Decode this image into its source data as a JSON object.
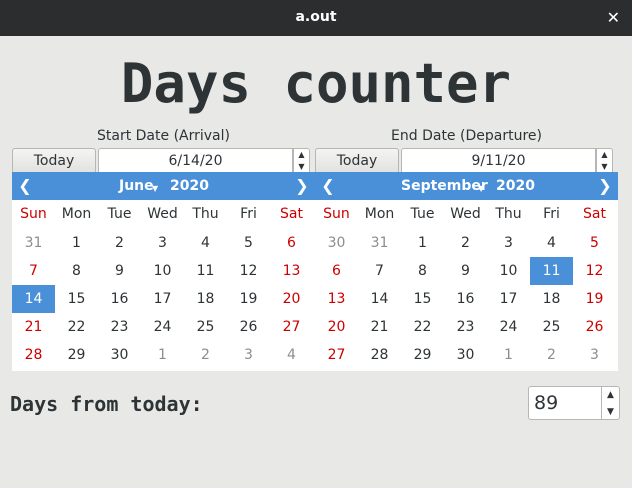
{
  "window": {
    "title": "a.out",
    "close_glyph": "✕"
  },
  "heading": "Days counter",
  "start": {
    "label": "Start Date (Arrival)",
    "today_label": "Today",
    "date_value": "6/14/20",
    "calendar": {
      "month": "June",
      "year": "2020",
      "weekdays": [
        "Sun",
        "Mon",
        "Tue",
        "Wed",
        "Thu",
        "Fri",
        "Sat"
      ],
      "weeks": [
        [
          {
            "d": "31",
            "o": true
          },
          {
            "d": "1"
          },
          {
            "d": "2"
          },
          {
            "d": "3"
          },
          {
            "d": "4"
          },
          {
            "d": "5"
          },
          {
            "d": "6"
          }
        ],
        [
          {
            "d": "7"
          },
          {
            "d": "8"
          },
          {
            "d": "9"
          },
          {
            "d": "10"
          },
          {
            "d": "11"
          },
          {
            "d": "12"
          },
          {
            "d": "13"
          }
        ],
        [
          {
            "d": "14",
            "s": true
          },
          {
            "d": "15"
          },
          {
            "d": "16"
          },
          {
            "d": "17"
          },
          {
            "d": "18"
          },
          {
            "d": "19"
          },
          {
            "d": "20"
          }
        ],
        [
          {
            "d": "21"
          },
          {
            "d": "22"
          },
          {
            "d": "23"
          },
          {
            "d": "24"
          },
          {
            "d": "25"
          },
          {
            "d": "26"
          },
          {
            "d": "27"
          }
        ],
        [
          {
            "d": "28"
          },
          {
            "d": "29"
          },
          {
            "d": "30"
          },
          {
            "d": "1",
            "o": true
          },
          {
            "d": "2",
            "o": true
          },
          {
            "d": "3",
            "o": true
          },
          {
            "d": "4",
            "o": true
          }
        ]
      ]
    }
  },
  "end": {
    "label": "End Date (Departure)",
    "today_label": "Today",
    "date_value": "9/11/20",
    "calendar": {
      "month": "September",
      "year": "2020",
      "weekdays": [
        "Sun",
        "Mon",
        "Tue",
        "Wed",
        "Thu",
        "Fri",
        "Sat"
      ],
      "weeks": [
        [
          {
            "d": "30",
            "o": true
          },
          {
            "d": "31",
            "o": true
          },
          {
            "d": "1"
          },
          {
            "d": "2"
          },
          {
            "d": "3"
          },
          {
            "d": "4"
          },
          {
            "d": "5"
          }
        ],
        [
          {
            "d": "6"
          },
          {
            "d": "7"
          },
          {
            "d": "8"
          },
          {
            "d": "9"
          },
          {
            "d": "10"
          },
          {
            "d": "11",
            "s": true
          },
          {
            "d": "12"
          }
        ],
        [
          {
            "d": "13"
          },
          {
            "d": "14"
          },
          {
            "d": "15"
          },
          {
            "d": "16"
          },
          {
            "d": "17"
          },
          {
            "d": "18"
          },
          {
            "d": "19"
          }
        ],
        [
          {
            "d": "20"
          },
          {
            "d": "21"
          },
          {
            "d": "22"
          },
          {
            "d": "23"
          },
          {
            "d": "24"
          },
          {
            "d": "25"
          },
          {
            "d": "26"
          }
        ],
        [
          {
            "d": "27"
          },
          {
            "d": "28"
          },
          {
            "d": "29"
          },
          {
            "d": "30"
          },
          {
            "d": "1",
            "o": true
          },
          {
            "d": "2",
            "o": true
          },
          {
            "d": "3",
            "o": true
          }
        ]
      ]
    }
  },
  "footer": {
    "label": "Days from today:",
    "count_value": "89"
  },
  "colors": {
    "accent": "#4a90d9",
    "weekend": "#cc0000",
    "titlebar": "#2c2d2f",
    "background": "#e8e8e7"
  },
  "icons": {
    "close": "close-icon",
    "prev_month": "chevron-left-icon",
    "next_year": "chevron-right-icon",
    "month_menu": "caret-down-icon",
    "spin_up": "caret-up-icon",
    "spin_down": "caret-down-icon"
  }
}
